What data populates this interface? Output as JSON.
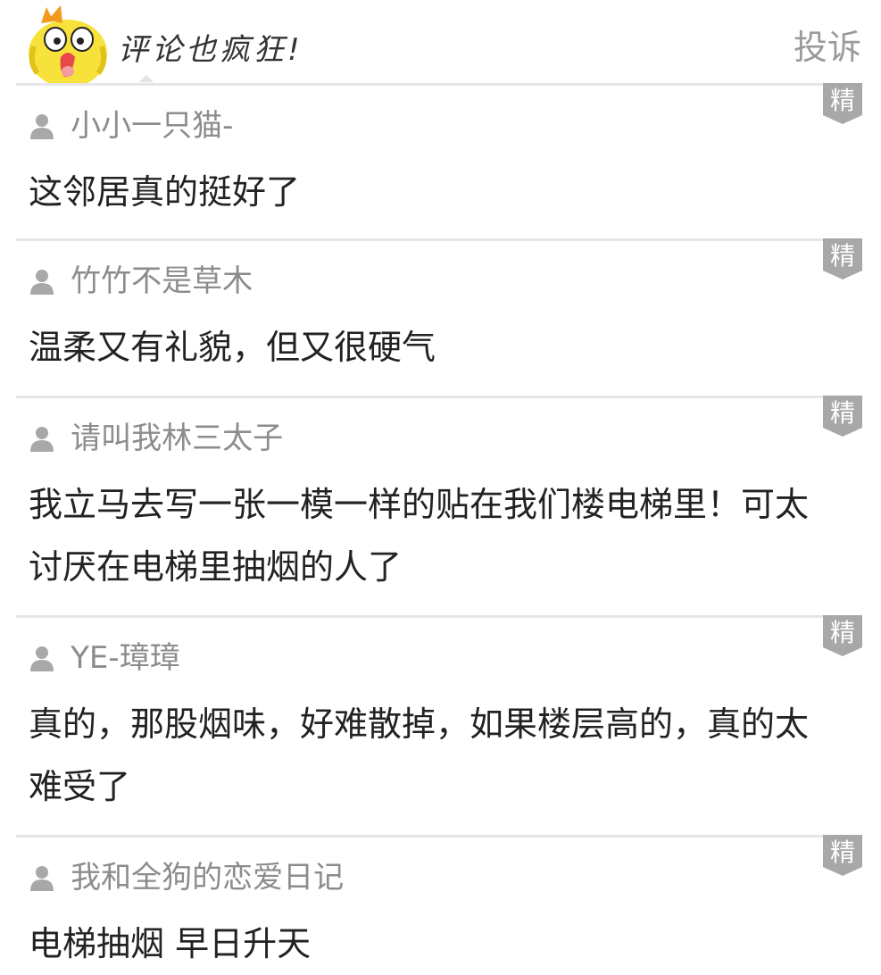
{
  "header": {
    "title": "评论也疯狂!",
    "report_label": "投诉"
  },
  "badge_label": "精",
  "colors": {
    "badge": "#a8a8a8",
    "divider": "#e6e6e6",
    "username": "#8c8c8c",
    "text": "#222222"
  },
  "comments": [
    {
      "user": "小小一只猫-",
      "text": "这邻居真的挺好了"
    },
    {
      "user": "竹竹不是草木",
      "text": "温柔又有礼貌，但又很硬气"
    },
    {
      "user": "请叫我林三太子",
      "text": "我立马去写一张一模一样的贴在我们楼电梯里！可太讨厌在电梯里抽烟的人了"
    },
    {
      "user": "YE-璋璋",
      "text": "真的，那股烟味，好难散掉，如果楼层高的，真的太难受了"
    },
    {
      "user": "我和全狗的恋爱日记",
      "text": "电梯抽烟 早日升天"
    }
  ]
}
